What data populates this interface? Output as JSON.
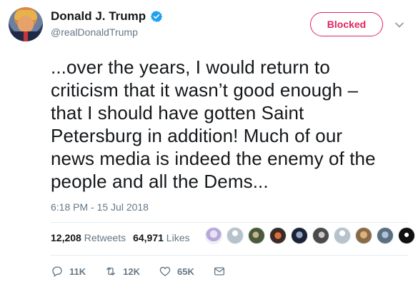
{
  "author": {
    "display_name": "Donald J. Trump",
    "handle": "@realDonaldTrump",
    "verified": true
  },
  "header": {
    "blocked_label": "Blocked"
  },
  "tweet": {
    "lines": [
      "...over the years, I would return to",
      "criticism that it wasn’t good enough –",
      "that I should have gotten Saint",
      "Petersburg in addition! Much of our",
      "news media is indeed the enemy of the",
      "people and all the Dems..."
    ],
    "timestamp": "6:18 PM - 15 Jul 2018"
  },
  "stats": {
    "retweets_count": "12,208",
    "retweets_label": "Retweets",
    "likes_count": "64,971",
    "likes_label": "Likes"
  },
  "liker_avatars": [
    "avatar-1",
    "avatar-2",
    "avatar-3",
    "avatar-4",
    "avatar-5",
    "avatar-6",
    "avatar-7",
    "avatar-8",
    "avatar-9",
    "avatar-10"
  ],
  "actions": {
    "replies": "11K",
    "retweets": "12K",
    "likes": "65K"
  },
  "colors": {
    "blocked": "#e0245e",
    "verified": "#1da1f2",
    "muted": "#657786",
    "text": "#14171a"
  }
}
